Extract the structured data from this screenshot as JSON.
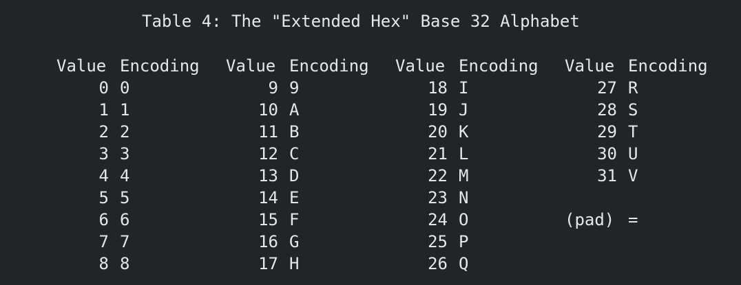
{
  "title": "Table 4: The \"Extended Hex\" Base 32 Alphabet",
  "columns": [
    "Value",
    "Encoding"
  ],
  "groups": [
    {
      "rows": [
        {
          "value": "0",
          "encoding": "0"
        },
        {
          "value": "1",
          "encoding": "1"
        },
        {
          "value": "2",
          "encoding": "2"
        },
        {
          "value": "3",
          "encoding": "3"
        },
        {
          "value": "4",
          "encoding": "4"
        },
        {
          "value": "5",
          "encoding": "5"
        },
        {
          "value": "6",
          "encoding": "6"
        },
        {
          "value": "7",
          "encoding": "7"
        },
        {
          "value": "8",
          "encoding": "8"
        }
      ]
    },
    {
      "rows": [
        {
          "value": "9",
          "encoding": "9"
        },
        {
          "value": "10",
          "encoding": "A"
        },
        {
          "value": "11",
          "encoding": "B"
        },
        {
          "value": "12",
          "encoding": "C"
        },
        {
          "value": "13",
          "encoding": "D"
        },
        {
          "value": "14",
          "encoding": "E"
        },
        {
          "value": "15",
          "encoding": "F"
        },
        {
          "value": "16",
          "encoding": "G"
        },
        {
          "value": "17",
          "encoding": "H"
        }
      ]
    },
    {
      "rows": [
        {
          "value": "18",
          "encoding": "I"
        },
        {
          "value": "19",
          "encoding": "J"
        },
        {
          "value": "20",
          "encoding": "K"
        },
        {
          "value": "21",
          "encoding": "L"
        },
        {
          "value": "22",
          "encoding": "M"
        },
        {
          "value": "23",
          "encoding": "N"
        },
        {
          "value": "24",
          "encoding": "O"
        },
        {
          "value": "25",
          "encoding": "P"
        },
        {
          "value": "26",
          "encoding": "Q"
        }
      ]
    },
    {
      "rows": [
        {
          "value": "27",
          "encoding": "R"
        },
        {
          "value": "28",
          "encoding": "S"
        },
        {
          "value": "29",
          "encoding": "T"
        },
        {
          "value": "30",
          "encoding": "U"
        },
        {
          "value": "31",
          "encoding": "V"
        },
        {
          "value": "",
          "encoding": ""
        },
        {
          "value": "(pad)",
          "encoding": "="
        }
      ]
    }
  ]
}
